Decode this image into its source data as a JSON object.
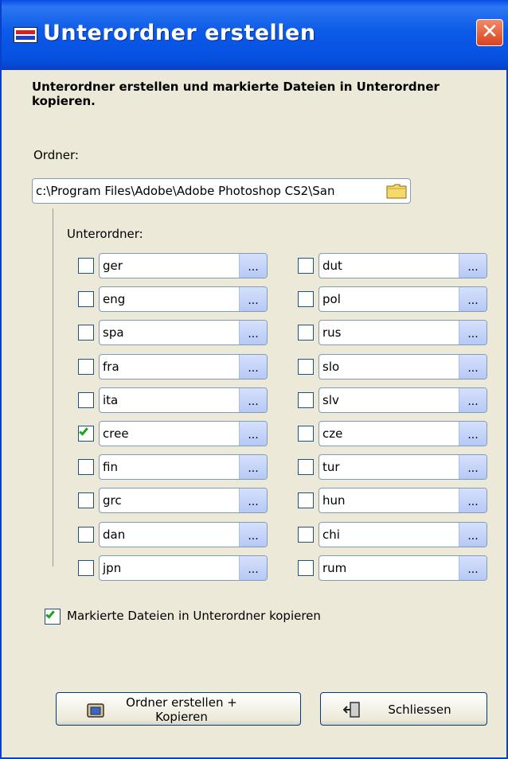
{
  "window": {
    "title": "Unterordner erstellen",
    "close_label": "✕"
  },
  "description": "Unterordner erstellen und markierte Dateien in Unterordner kopieren.",
  "folder": {
    "label": "Ordner:",
    "path": "c:\\Program Files\\Adobe\\Adobe Photoshop CS2\\San"
  },
  "subfolders": {
    "label": "Unterordner:",
    "browse_label": "...",
    "left": [
      {
        "name": "ger",
        "checked": false
      },
      {
        "name": "eng",
        "checked": false
      },
      {
        "name": "spa",
        "checked": false
      },
      {
        "name": "fra",
        "checked": false
      },
      {
        "name": "ita",
        "checked": false
      },
      {
        "name": "cree",
        "checked": true
      },
      {
        "name": "fin",
        "checked": false
      },
      {
        "name": "grc",
        "checked": false
      },
      {
        "name": "dan",
        "checked": false
      },
      {
        "name": "jpn",
        "checked": false
      }
    ],
    "right": [
      {
        "name": "dut",
        "checked": false
      },
      {
        "name": "pol",
        "checked": false
      },
      {
        "name": "rus",
        "checked": false
      },
      {
        "name": "slo",
        "checked": false
      },
      {
        "name": "slv",
        "checked": false
      },
      {
        "name": "cze",
        "checked": false
      },
      {
        "name": "tur",
        "checked": false
      },
      {
        "name": "hun",
        "checked": false
      },
      {
        "name": "chi",
        "checked": false
      },
      {
        "name": "rum",
        "checked": false
      }
    ]
  },
  "copy_option": {
    "label": "Markierte Dateien in Unterordner kopieren",
    "checked": true
  },
  "buttons": {
    "create_line1": "Ordner erstellen +",
    "create_line2": "Kopieren",
    "close": "Schliessen"
  }
}
